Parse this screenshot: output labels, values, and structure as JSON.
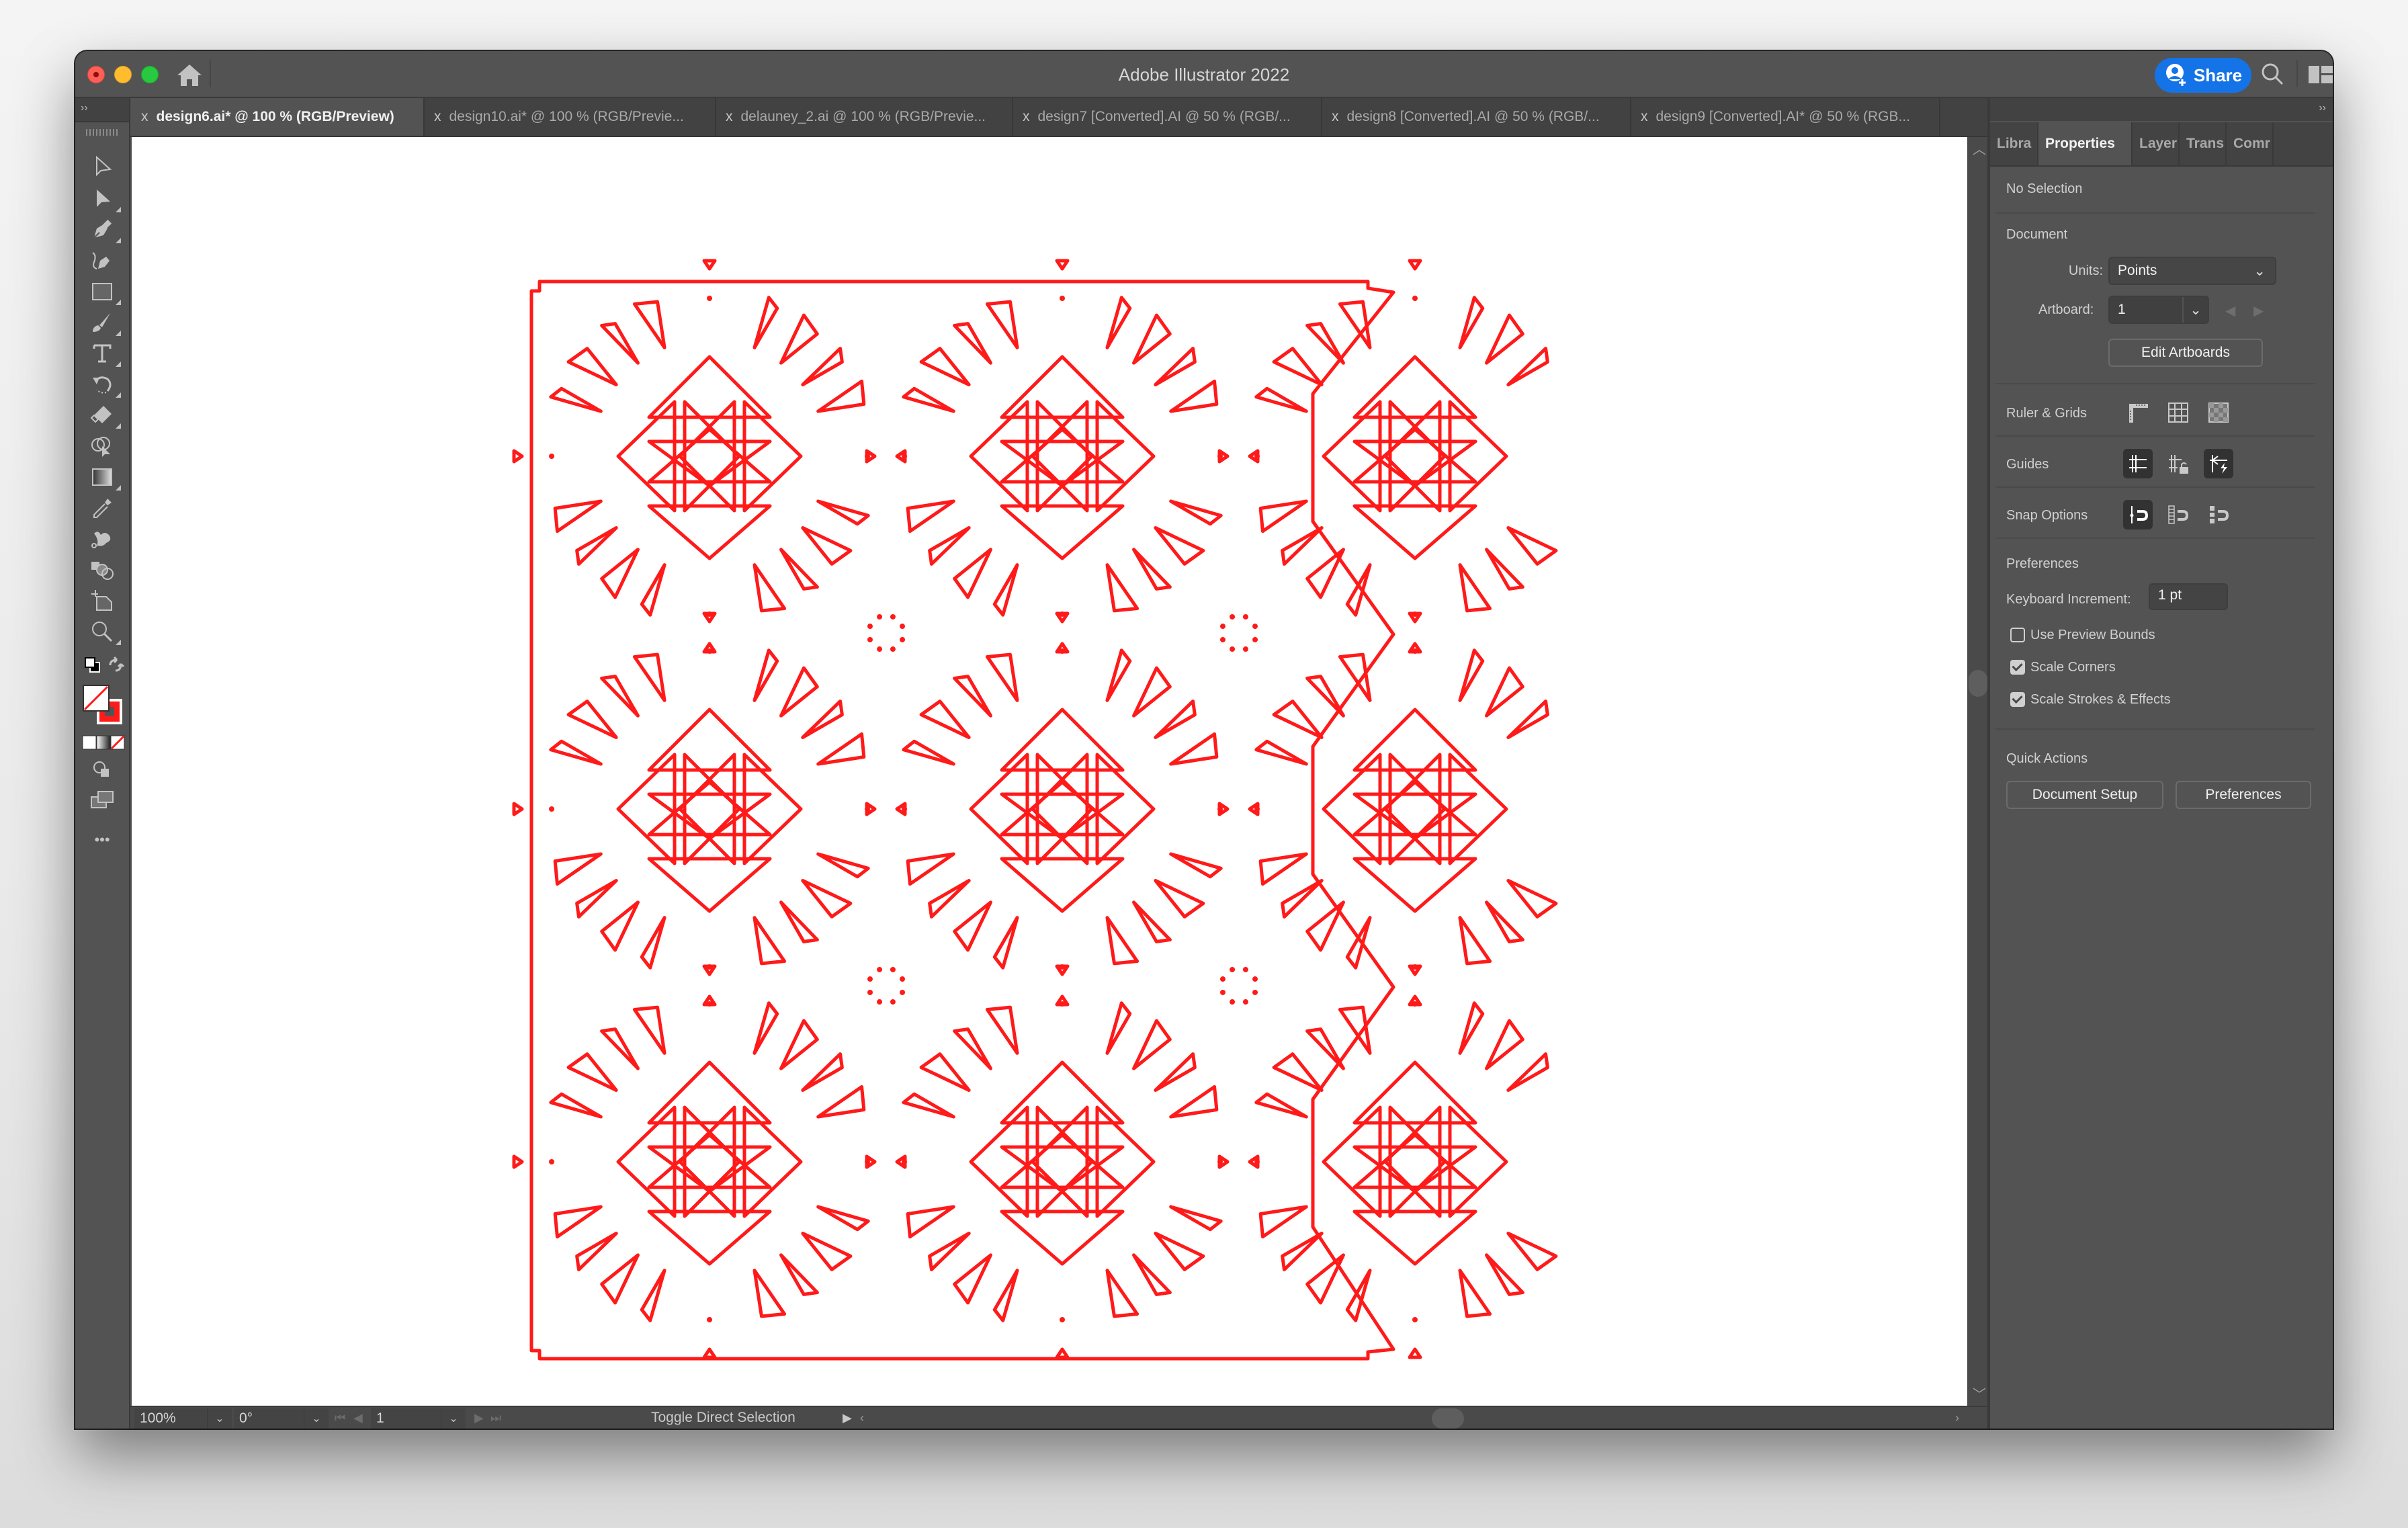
{
  "window": {
    "title": "Adobe Illustrator 2022",
    "share_label": "Share"
  },
  "tabs": [
    {
      "label": "design6.ai* @ 100 % (RGB/Preview)",
      "active": true
    },
    {
      "label": "design10.ai* @ 100 % (RGB/Previe...",
      "active": false
    },
    {
      "label": "delauney_2.ai @ 100 % (RGB/Previe...",
      "active": false
    },
    {
      "label": "design7 [Converted].AI @ 50 % (RGB/...",
      "active": false
    },
    {
      "label": "design8 [Converted].AI @ 50 % (RGB/...",
      "active": false
    },
    {
      "label": "design9 [Converted].AI* @ 50 % (RGB...",
      "active": false
    }
  ],
  "tab_close_glyph": "x",
  "toolbar": {
    "collapse_glyph": "››",
    "tools": [
      "direct-selection-tool",
      "selection-tool",
      "pen-tool",
      "curvature-tool",
      "rectangle-tool",
      "paintbrush-tool",
      "type-tool",
      "rotate-tool",
      "eraser-tool",
      "shape-builder-tool",
      "gradient-tool",
      "eyedropper-tool",
      "puppet-warp-tool",
      "blend-tool",
      "artboard-tool",
      "zoom-tool"
    ],
    "fill": "none",
    "stroke_color": "#ff1a1a",
    "more_glyph": "•••"
  },
  "status_bar": {
    "zoom": "100%",
    "rotation": "0°",
    "artboard": "1",
    "tool_status": "Toggle Direct Selection"
  },
  "panel": {
    "collapse_glyph": "››",
    "tabs": [
      {
        "label": "Libra",
        "active": false
      },
      {
        "label": "Properties",
        "active": true
      },
      {
        "label": "Layer",
        "active": false
      },
      {
        "label": "Trans",
        "active": false
      },
      {
        "label": "Comr",
        "active": false
      }
    ],
    "selection_state": "No Selection",
    "document": {
      "heading": "Document",
      "units_label": "Units:",
      "units_value": "Points",
      "artboard_label": "Artboard:",
      "artboard_value": "1",
      "edit_artboards": "Edit Artboards"
    },
    "ruler_grids_label": "Ruler & Grids",
    "guides_label": "Guides",
    "snap_options_label": "Snap Options",
    "preferences": {
      "heading": "Preferences",
      "keyboard_increment_label": "Keyboard Increment:",
      "keyboard_increment_value": "1 pt",
      "use_preview_bounds": {
        "label": "Use Preview Bounds",
        "checked": false
      },
      "scale_corners": {
        "label": "Scale Corners",
        "checked": true
      },
      "scale_strokes_effects": {
        "label": "Scale Strokes & Effects",
        "checked": true
      }
    },
    "quick_actions": {
      "heading": "Quick Actions",
      "document_setup": "Document Setup",
      "preferences": "Preferences"
    }
  },
  "artwork": {
    "stroke_color": "#ff1a1a",
    "tile_rows": 3,
    "tile_columns": 3,
    "motif": "papel-picado triangle medallion"
  }
}
